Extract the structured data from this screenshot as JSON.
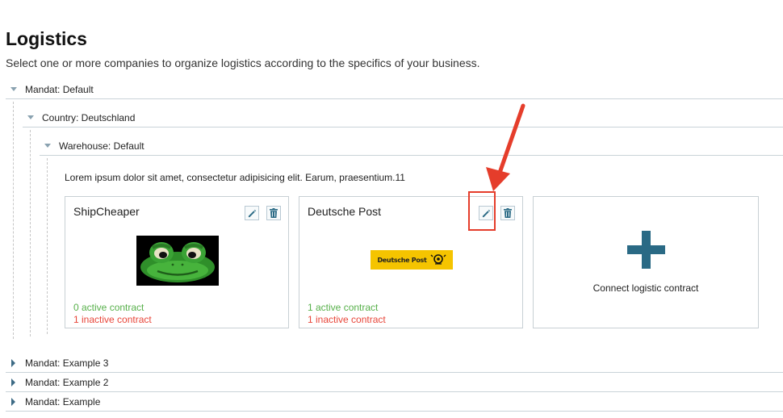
{
  "page": {
    "title": "Logistics",
    "subtitle": "Select one or more companies to organize logistics according to the specifics of your business."
  },
  "tree": {
    "mandat_default": "Mandat: Default",
    "country": "Country: Deutschland",
    "warehouse": "Warehouse: Default",
    "description": "Lorem ipsum dolor sit amet, consectetur adipisicing elit. Earum, praesentium.11",
    "collapsed": [
      "Mandat: Example 3",
      "Mandat: Example 2",
      "Mandat: Example"
    ]
  },
  "cards": [
    {
      "name": "ShipCheaper",
      "logo": "frog-logo",
      "active": "0 active contract",
      "inactive": "1 inactive contract"
    },
    {
      "name": "Deutsche Post",
      "logo": "deutsche-post-logo",
      "logo_text": "Deutsche Post",
      "active": "1 active contract",
      "inactive": "1 inactive contract"
    }
  ],
  "add_card": {
    "label": "Connect logistic contract",
    "icon": "plus-icon"
  },
  "icons": {
    "edit": "pencil-icon",
    "delete": "trash-icon"
  },
  "colors": {
    "accent": "#2a6a85",
    "active": "#57b04a",
    "inactive": "#e8463a",
    "annotation": "#e53d2b",
    "deutsche_post_yellow": "#f5c400"
  }
}
